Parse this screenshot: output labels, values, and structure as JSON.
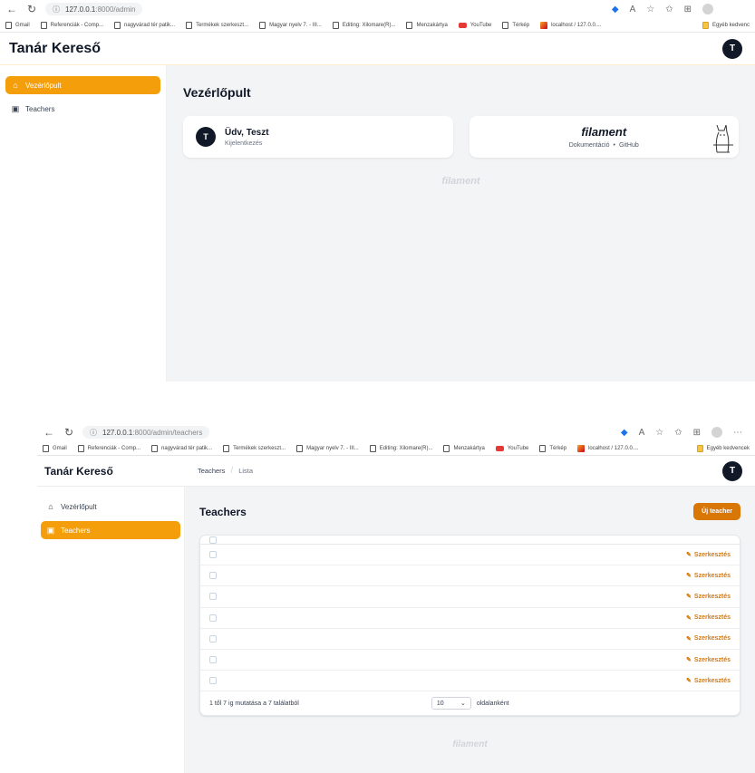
{
  "screens": [
    {
      "browser": {
        "url": "127.0.0.1",
        "url_path": ":8000/admin",
        "bookmarks": [
          "Gmail",
          "Referenciák - Comp...",
          "nagyvárad tér patik...",
          "Termékek szerkeszt...",
          "Magyar nyelv 7. - III...",
          "Editing: Xilomare(R)...",
          "Menzakártya",
          "YouTube",
          "Térkép",
          "localhost / 127.0.0...."
        ],
        "bookmarks_right": "Egyéb kedvenc"
      },
      "app": {
        "brand": "Tanár Kereső",
        "user_initial": "T",
        "sidebar": [
          {
            "label": "Vezérlőpult",
            "icon": "home-icon",
            "active": true
          },
          {
            "label": "Teachers",
            "icon": "briefcase-icon",
            "active": false
          }
        ],
        "page_title": "Vezérlőpult",
        "welcome": "Üdv, Teszt",
        "logout": "Kijelentkezés",
        "filament_logo": "filament",
        "doc_link": "Dokumentáció",
        "dot": "•",
        "github_link": "GitHub",
        "footer_logo": "filament"
      }
    },
    {
      "browser": {
        "url": "127.0.0.1",
        "url_path": ":8000/admin/teachers",
        "bookmarks": [
          "Gmail",
          "Referenciák - Comp...",
          "nagyvárad tér patik...",
          "Termékek szerkeszt...",
          "Magyar nyelv 7. - III...",
          "Editing: Xilomare(R)...",
          "Menzakártya",
          "YouTube",
          "Térkép",
          "localhost / 127.0.0...."
        ],
        "bookmarks_right": "Egyéb kedvencek"
      },
      "app": {
        "brand": "Tanár Kereső",
        "user_initial": "T",
        "breadcrumb": [
          "Teachers",
          "Lista"
        ],
        "sidebar": [
          {
            "label": "Vezérlőpult",
            "icon": "home-icon",
            "active": false
          },
          {
            "label": "Teachers",
            "icon": "briefcase-icon",
            "active": true
          }
        ],
        "page_title": "Teachers",
        "new_button": "Új teacher",
        "rows": [
          {
            "action": "Szerkesztés"
          },
          {
            "action": "Szerkesztés"
          },
          {
            "action": "Szerkesztés"
          },
          {
            "action": "Szerkesztés"
          },
          {
            "action": "Szerkesztés"
          },
          {
            "action": "Szerkesztés"
          },
          {
            "action": "Szerkesztés"
          }
        ],
        "pagination_text": "1 től 7 ig mutatása a 7 találatból",
        "per_page_value": "10",
        "per_page_label": "oldalanként",
        "footer_logo": "filament"
      }
    }
  ],
  "colors": {
    "accent": "#f59e0b",
    "accent_dark": "#d97706",
    "bg": "#f3f4f6",
    "avatar": "#111827"
  }
}
